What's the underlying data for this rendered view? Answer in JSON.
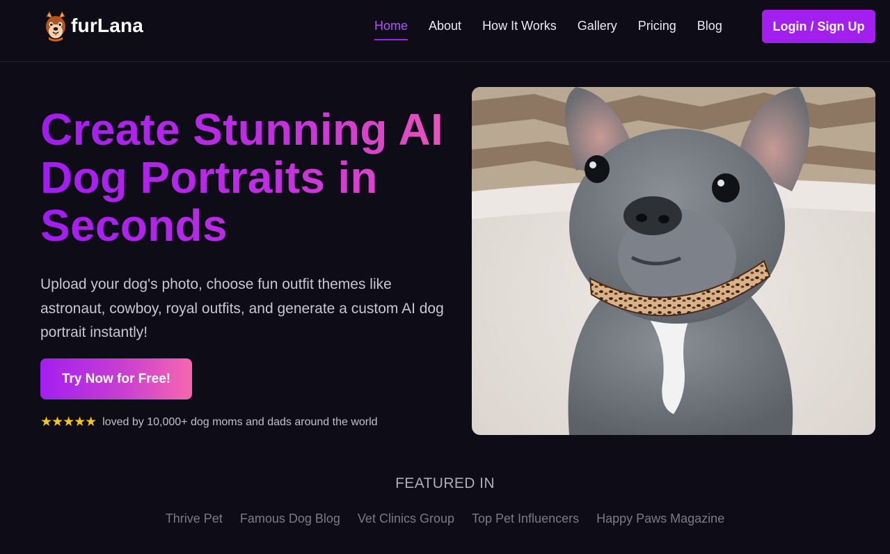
{
  "brand": {
    "name": "furLana",
    "logo_icon": "dog-face-icon"
  },
  "nav": {
    "items": [
      {
        "label": "Home",
        "active": true
      },
      {
        "label": "About",
        "active": false
      },
      {
        "label": "How It Works",
        "active": false
      },
      {
        "label": "Gallery",
        "active": false
      },
      {
        "label": "Pricing",
        "active": false
      },
      {
        "label": "Blog",
        "active": false
      }
    ],
    "login_label": "Login / Sign Up"
  },
  "hero": {
    "headline": "Create Stunning AI Dog Portraits in Seconds",
    "subtext": "Upload your dog's photo, choose fun outfit themes like astronaut, cowboy, royal outfits, and generate a custom AI dog portrait instantly!",
    "cta_label": "Try Now for Free!",
    "rating_stars": "★★★★★",
    "rating_text": "loved by 10,000+ dog moms and dads around the world",
    "image_subject": "french-bulldog-puppy-photo"
  },
  "featured": {
    "title": "FEATURED IN",
    "items": [
      "Thrive Pet",
      "Famous Dog Blog",
      "Vet Clinics Group",
      "Top Pet Influencers",
      "Happy Paws Magazine"
    ]
  },
  "colors": {
    "background": "#0e0c16",
    "accent": "#a21ff0",
    "gradient_end": "#f768ae",
    "star": "#f5c518"
  }
}
